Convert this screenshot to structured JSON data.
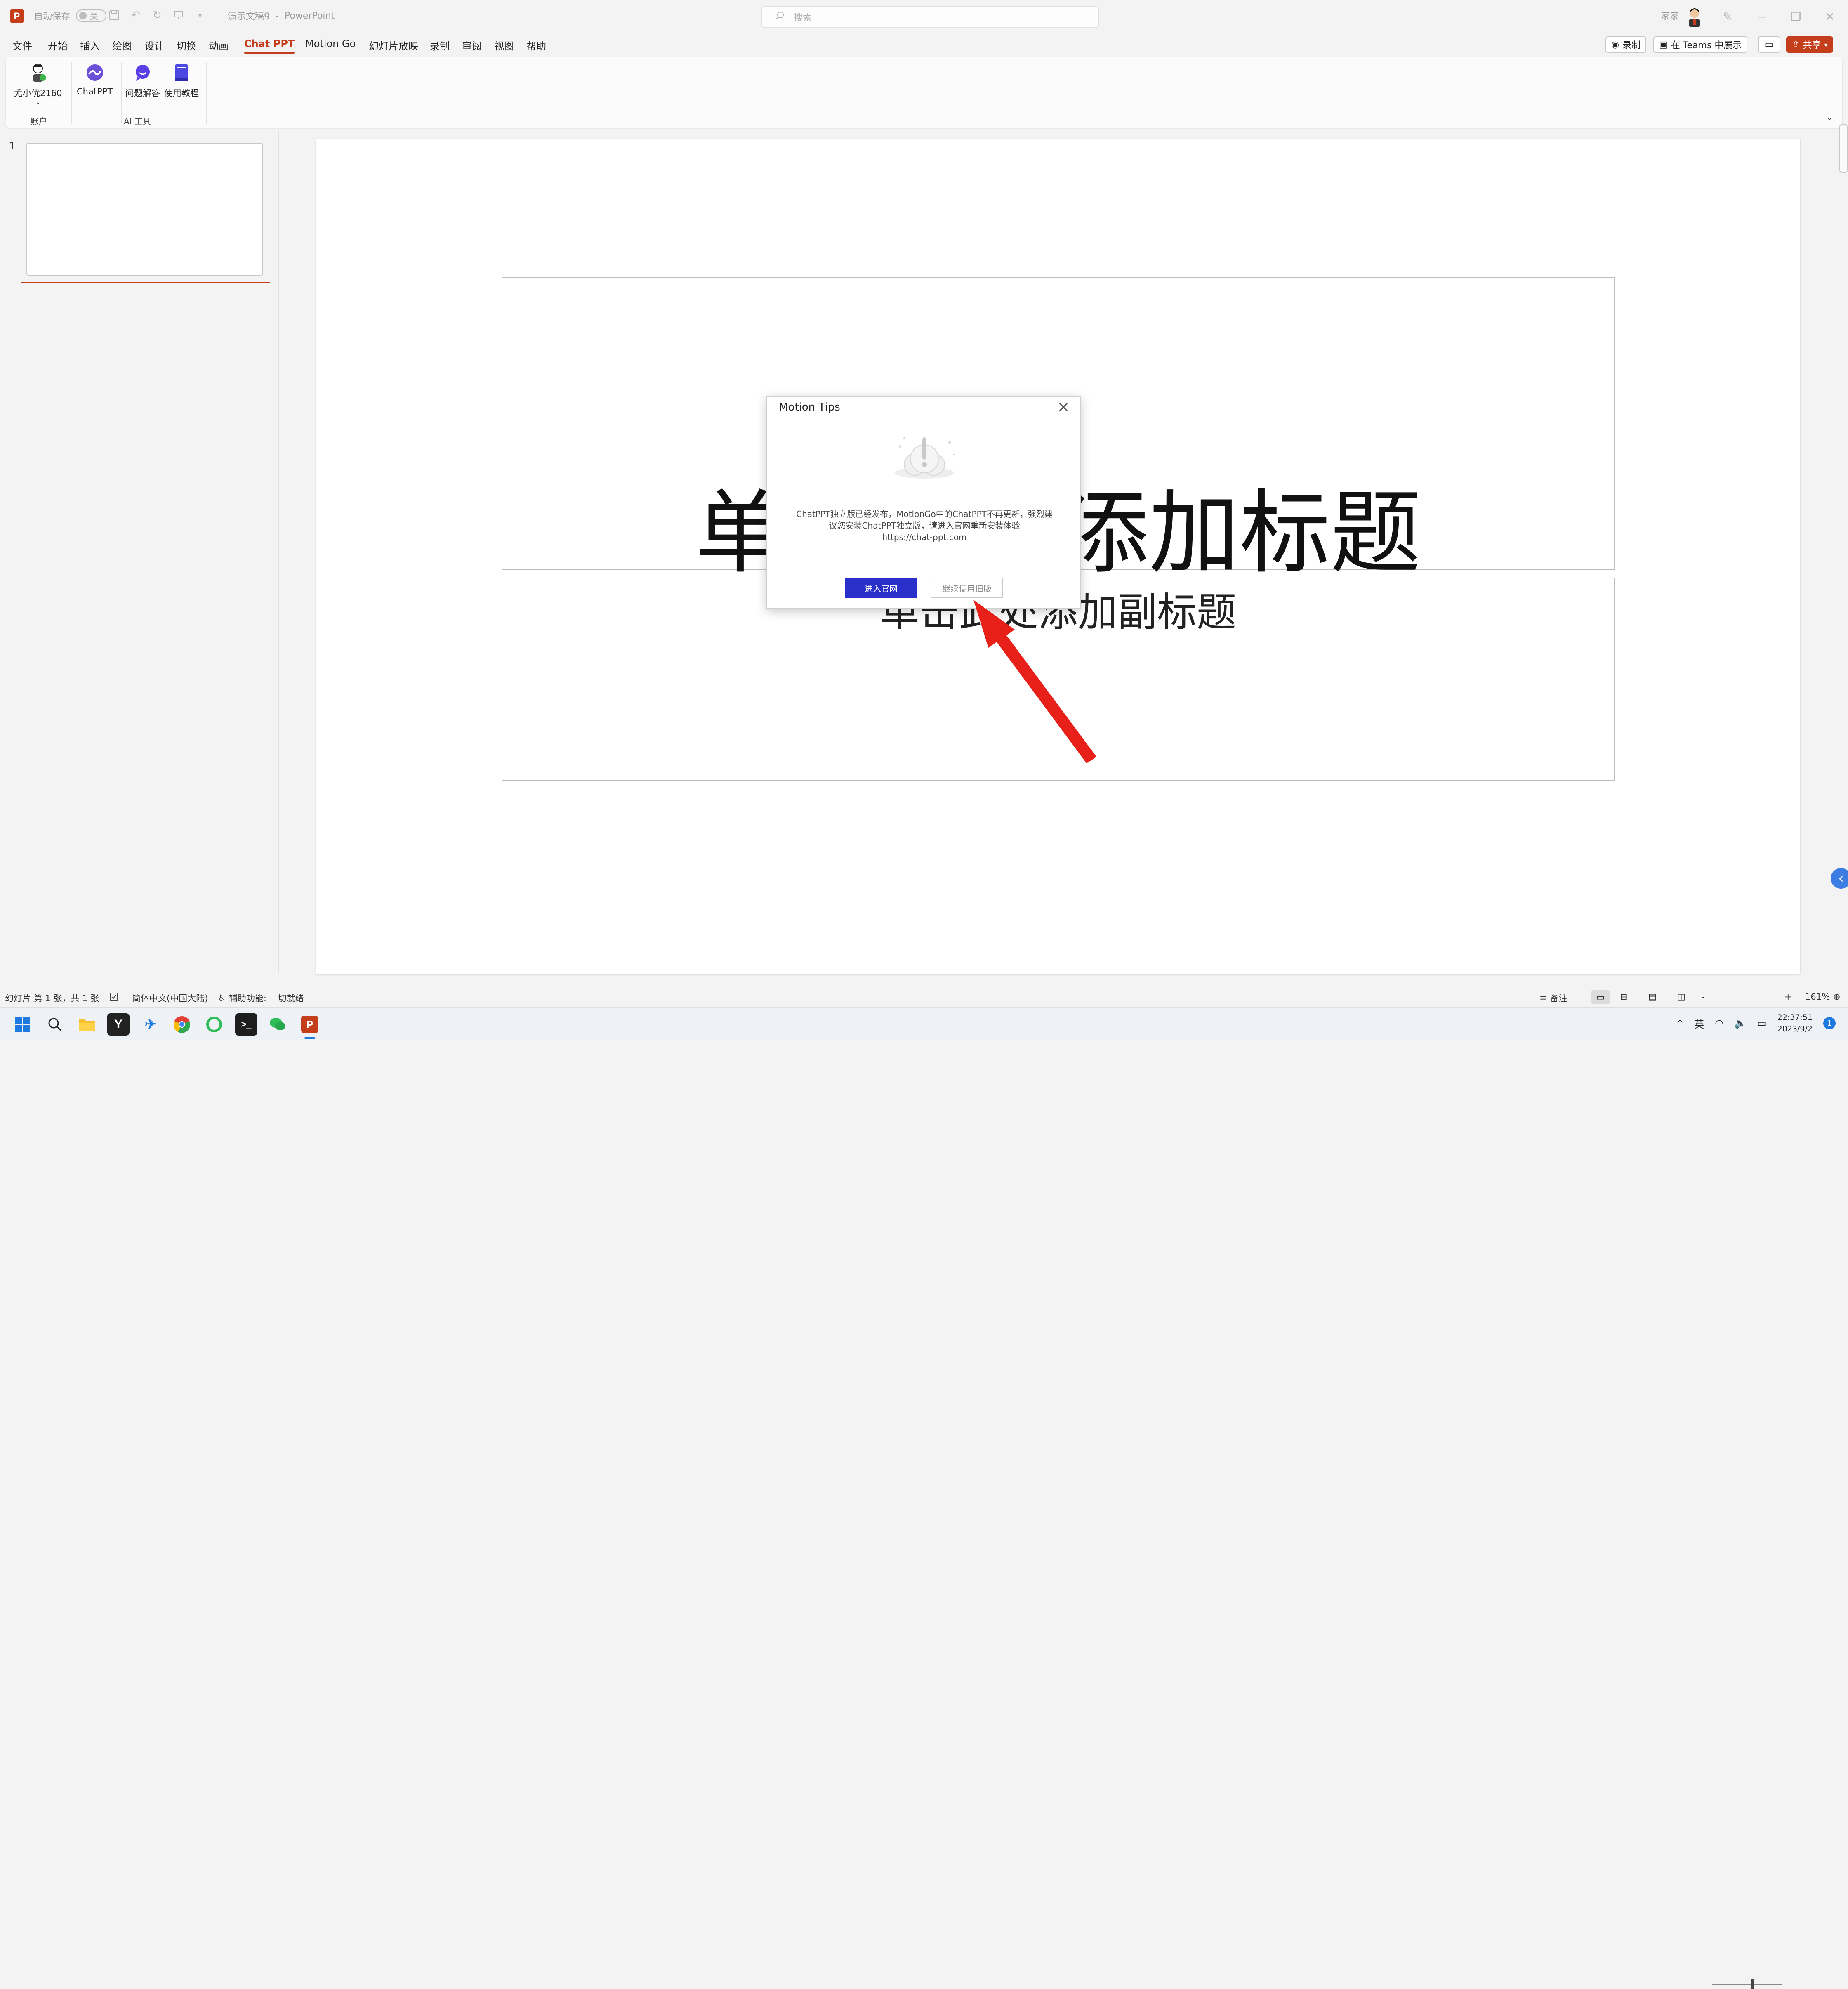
{
  "app": {
    "autosave_label": "自动保存",
    "autosave_state": "关",
    "document_title": "演示文稿9",
    "app_name": "PowerPoint",
    "separator": "-",
    "search_placeholder": "搜索",
    "user_name": "家家",
    "brand_color": "#c43e1c"
  },
  "menu": {
    "tabs": [
      "文件",
      "开始",
      "插入",
      "绘图",
      "设计",
      "切换",
      "动画",
      "Chat PPT",
      "Motion Go",
      "幻灯片放映",
      "录制",
      "审阅",
      "视图",
      "帮助"
    ],
    "active_tab": "Chat PPT",
    "record_btn": "录制",
    "teams_btn": "在 Teams 中展示",
    "share_btn": "共享"
  },
  "ribbon": {
    "account_name": "尤小优2160",
    "chatppt": "ChatPPT",
    "qa": "问题解答",
    "tutorial": "使用教程",
    "group_account": "账户",
    "group_ai": "AI 工具"
  },
  "thumbs": {
    "slide_number": "1"
  },
  "slide": {
    "title_placeholder": "单击此处添加标题",
    "subtitle_placeholder": "单击此处添加副标题"
  },
  "dialog": {
    "title": "Motion Tips",
    "message_line1": "ChatPPT独立版已经发布，MotionGo中的ChatPPT不再更新，强烈建",
    "message_line2": "议您安装ChatPPT独立版，请进入官网重新安装体验",
    "message_line3": "https://chat-ppt.com",
    "visit_btn": "进入官网",
    "continue_btn": "继续使用旧版",
    "accent_color": "#2b2fc9"
  },
  "status": {
    "slide_info": "幻灯片 第 1 张，共 1 张",
    "language": "简体中文(中国大陆)",
    "accessibility": "辅助功能: 一切就绪",
    "notes": "备注",
    "zoom": "161%",
    "zoom_minus": "-",
    "zoom_plus": "+"
  },
  "taskbar": {
    "ime": "英",
    "time": "22:37:51",
    "date": "2023/9/2",
    "notification_count": "1"
  }
}
